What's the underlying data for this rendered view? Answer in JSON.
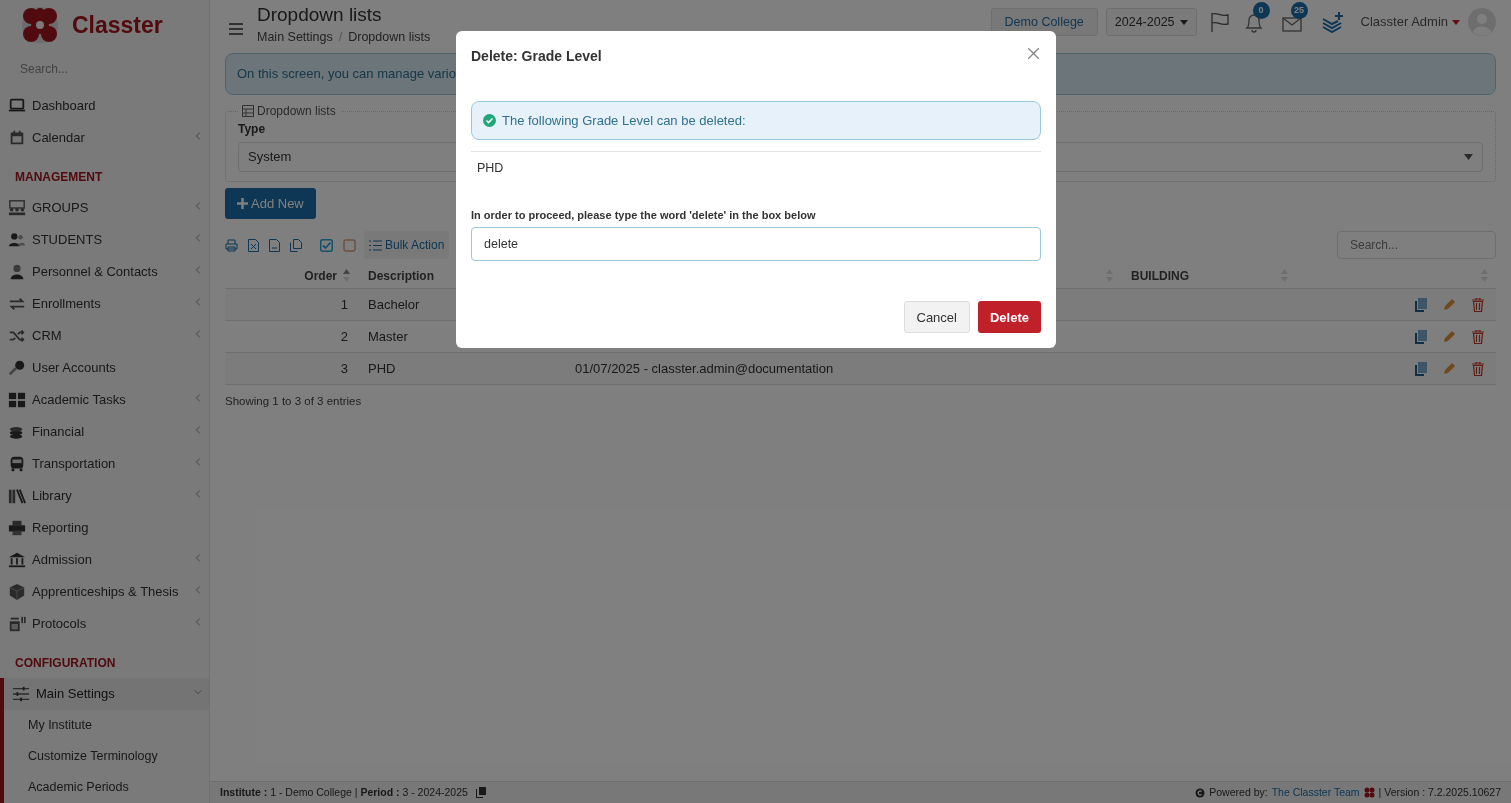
{
  "sidebar": {
    "logo": "Classter",
    "search_placeholder": "Search...",
    "items": [
      {
        "kind": "item",
        "label": "Dashboard",
        "expandable": false,
        "selected": false
      },
      {
        "kind": "item",
        "label": "Calendar",
        "expandable": true,
        "expanded": false,
        "selected": false
      },
      {
        "kind": "heading",
        "label": "MANAGEMENT"
      },
      {
        "kind": "item",
        "label": "GROUPS",
        "expandable": true,
        "expanded": false,
        "selected": false
      },
      {
        "kind": "item",
        "label": "STUDENTS",
        "expandable": true,
        "expanded": false,
        "selected": false
      },
      {
        "kind": "item",
        "label": "Personnel & Contacts",
        "expandable": true,
        "expanded": false,
        "selected": false
      },
      {
        "kind": "item",
        "label": "Enrollments",
        "expandable": true,
        "expanded": false,
        "selected": false
      },
      {
        "kind": "item",
        "label": "CRM",
        "expandable": true,
        "expanded": false,
        "selected": false
      },
      {
        "kind": "item",
        "label": "User Accounts",
        "expandable": false,
        "selected": false
      },
      {
        "kind": "item",
        "label": "Academic Tasks",
        "expandable": true,
        "expanded": false,
        "selected": false
      },
      {
        "kind": "item",
        "label": "Financial",
        "expandable": true,
        "expanded": false,
        "selected": false
      },
      {
        "kind": "item",
        "label": "Transportation",
        "expandable": true,
        "expanded": false,
        "selected": false
      },
      {
        "kind": "item",
        "label": "Library",
        "expandable": true,
        "expanded": false,
        "selected": false
      },
      {
        "kind": "item",
        "label": "Reporting",
        "expandable": false,
        "selected": false
      },
      {
        "kind": "item",
        "label": "Admission",
        "expandable": true,
        "expanded": false,
        "selected": false
      },
      {
        "kind": "item",
        "label": "Apprenticeships & Thesis",
        "expandable": true,
        "expanded": false,
        "selected": false
      },
      {
        "kind": "item",
        "label": "Protocols",
        "expandable": true,
        "expanded": false,
        "selected": false
      },
      {
        "kind": "heading",
        "label": "CONFIGURATION"
      },
      {
        "kind": "item",
        "label": "Main Settings",
        "expandable": true,
        "expanded": true,
        "selected": true,
        "children": [
          {
            "label": "My Institute"
          },
          {
            "label": "Customize Terminology"
          },
          {
            "label": "Academic Periods"
          }
        ]
      }
    ]
  },
  "header": {
    "title": "Dropdown lists",
    "breadcrumb": [
      "Main Settings",
      "Dropdown lists"
    ],
    "breadcrumb_separator": "/",
    "college": "Demo College",
    "period": "2024-2025",
    "notifications": "0",
    "messages": "25",
    "user": "Classter Admin"
  },
  "info": "On this screen, you can manage vario",
  "filter": {
    "legend": "Dropdown lists",
    "type_label": "Type",
    "type_value": "System"
  },
  "add_button": "Add New",
  "bulk_action": "Bulk Action",
  "table_search_placeholder": "Search...",
  "table": {
    "columns": [
      {
        "label": "Order",
        "sorted": true
      },
      {
        "label": "Description"
      },
      {
        "sorted": false
      },
      {
        "label": "BUILDING",
        "sorted": false
      },
      {
        "sorted": false
      }
    ],
    "rows": [
      {
        "order": "1",
        "description": "Bachelor"
      },
      {
        "order": "2",
        "description": "Master"
      },
      {
        "order": "3",
        "description": "PHD",
        "column_3": "01/07/2025 - classter.admin@documentation"
      }
    ]
  },
  "table_info": "Showing 1 to 3 of 3 entries",
  "footer": {
    "context": "**Institute :** 1 - Demo College | **Period :** 3 - 2024-2025",
    "powered": "Powered by:",
    "link": "The Classter Team",
    "version": "| Version : 7.2.2025.10627"
  },
  "modal": {
    "title": "Delete: Grade Level",
    "alert": "The following Grade Level can be deleted:",
    "item": "PHD",
    "prompt": "In order to proceed, please type the word 'delete' in the box below",
    "input_value": "delete",
    "buttons": [
      {
        "label": "Cancel",
        "kind": "secondary"
      },
      {
        "label": "Delete",
        "kind": "danger"
      }
    ]
  }
}
